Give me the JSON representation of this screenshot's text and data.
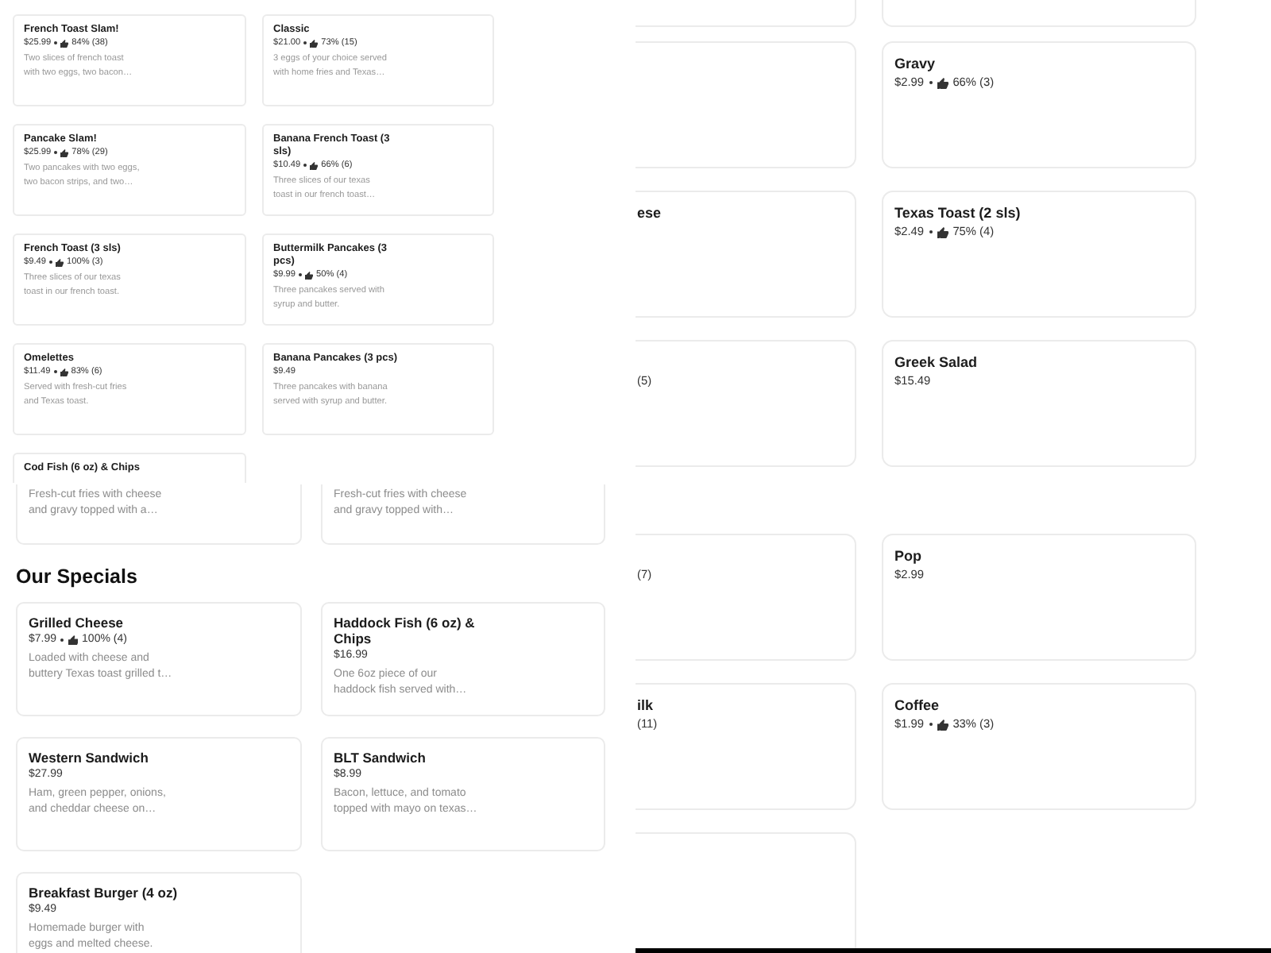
{
  "menu_views": [
    {
      "sections": [
        {
          "items": [
            {
              "kind": "dish",
              "title": "French Toast Slam!",
              "price": "$25.99",
              "rating": "84% (38)",
              "description": [
                "Two slices of french toast",
                "with two eggs, two bacon…"
              ]
            },
            {
              "kind": "dish",
              "title": "Classic",
              "price": "$21.00",
              "rating": "73% (15)",
              "description": [
                "3 eggs of your choice served",
                "with home fries and Texas…"
              ]
            },
            {
              "kind": "dish",
              "title": "Pancake Slam!",
              "price": "$25.99",
              "rating": "78% (29)",
              "description": [
                "Two pancakes with two eggs,",
                "two bacon strips, and two…"
              ]
            },
            {
              "kind": "dish",
              "title": "Banana French Toast (3 sls)",
              "price": "$10.49",
              "rating": "66% (6)",
              "description": [
                "Three slices of our texas",
                "toast in our french toast…"
              ]
            },
            {
              "kind": "dish",
              "title": "French Toast (3 sls)",
              "price": "$9.49",
              "rating": "100% (3)",
              "description": [
                "Three slices of our texas",
                "toast in our french toast."
              ]
            },
            {
              "kind": "dish",
              "title": "Buttermilk Pancakes (3 pcs)",
              "price": "$9.99",
              "rating": "50% (4)",
              "description": [
                "Three pancakes served with",
                "syrup and butter."
              ]
            },
            {
              "kind": "dish",
              "title": "Omelettes",
              "price": "$11.49",
              "rating": "83% (6)",
              "description": [
                "Served with fresh-cut fries",
                "and Texas toast."
              ]
            },
            {
              "kind": "dish",
              "title": "Banana Pancakes (3 pcs)",
              "price": "$9.49",
              "description": [
                "Three pancakes with banana",
                "served with syrup and butter."
              ]
            },
            {
              "kind": "dish",
              "title": "Cod Fish (6 oz) & Chips"
            }
          ]
        }
      ]
    },
    {
      "sections": [
        {
          "items": [
            {
              "kind": "dish",
              "description": [
                "Fresh-cut fries with cheese",
                "and gravy topped with a…"
              ]
            },
            {
              "kind": "dish",
              "description": [
                "Fresh-cut fries with cheese",
                "and gravy topped with…"
              ]
            }
          ]
        },
        {
          "heading": "Our Specials",
          "items": [
            {
              "kind": "dish",
              "title": "Grilled Cheese",
              "price": "$7.99",
              "rating": "100% (4)",
              "description": [
                "Loaded with cheese and",
                "buttery Texas toast grilled t…"
              ]
            },
            {
              "kind": "dish",
              "title": "Haddock Fish (6 oz) & Chips",
              "price": "$16.99",
              "description": [
                "One 6oz piece of our",
                "haddock fish served with…"
              ]
            },
            {
              "kind": "dish",
              "title": "Western Sandwich",
              "price": "$27.99",
              "description": [
                "Ham, green pepper, onions,",
                "and cheddar cheese on…"
              ]
            },
            {
              "kind": "dish",
              "title": "BLT Sandwich",
              "price": "$8.99",
              "description": [
                "Bacon, lettuce, and tomato",
                "topped with mayo on texas…"
              ]
            },
            {
              "kind": "dish",
              "title": "Breakfast Burger (4 oz)",
              "price": "$9.49",
              "description": [
                "Homemade burger with",
                "eggs and melted cheese."
              ]
            }
          ]
        }
      ]
    },
    {
      "sections": [
        {
          "items": [
            {
              "kind": "empty"
            },
            {
              "kind": "empty"
            },
            {
              "kind": "fragment",
              "title": "ese"
            },
            {
              "kind": "fragment",
              "rating": "(5)"
            },
            {
              "kind": "empty"
            },
            {
              "kind": "dish",
              "title": "Gravy",
              "price": "$2.99",
              "rating": "66% (3)"
            },
            {
              "kind": "dish",
              "title": "Texas Toast (2 sls)",
              "price": "$2.49",
              "rating": "75% (4)"
            },
            {
              "kind": "dish",
              "title": "Greek Salad",
              "price": "$15.49"
            }
          ]
        },
        {
          "items": [
            {
              "kind": "fragment",
              "rating": "(7)"
            },
            {
              "kind": "fragment",
              "title": "ilk",
              "rating": "(11)"
            },
            {
              "kind": "empty"
            },
            {
              "kind": "dish",
              "title": "Pop",
              "price": "$2.99"
            },
            {
              "kind": "dish",
              "title": "Coffee",
              "price": "$1.99",
              "rating": "33% (3)"
            }
          ]
        }
      ]
    }
  ]
}
